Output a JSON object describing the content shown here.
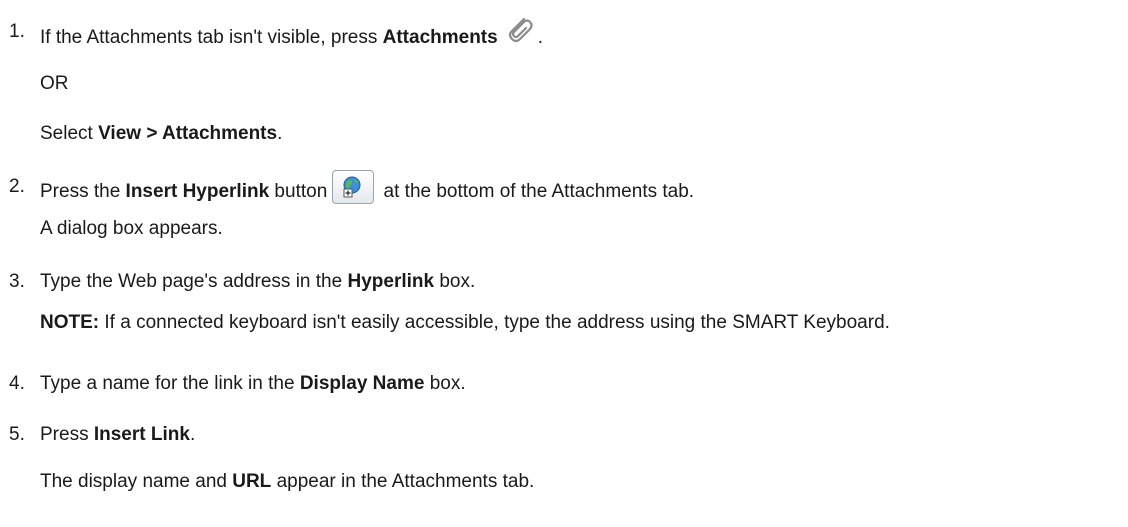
{
  "steps": [
    {
      "number": "1.",
      "lines": [
        {
          "t1": "If the Attachments tab isn't visible, press ",
          "b1": "Attachments",
          "t2": "."
        },
        {
          "text": "OR"
        },
        {
          "t1": "Select ",
          "b1": "View > Attachments",
          "t2": "."
        }
      ]
    },
    {
      "number": "2.",
      "lines": [
        {
          "t1": "Press the ",
          "b1": "Insert Hyperlink",
          "t2": " button",
          "t3": " at the bottom of the Attachments tab."
        },
        {
          "text": "A dialog box appears."
        }
      ]
    },
    {
      "number": "3.",
      "lines": [
        {
          "t1": "Type the Web page's address in the ",
          "b1": "Hyperlink",
          "t2": " box."
        },
        {
          "b1": "NOTE:",
          "t1": " If a connected keyboard isn't easily accessible, type the address using the SMART Keyboard."
        }
      ]
    },
    {
      "number": "4.",
      "lines": [
        {
          "t1": "Type a name for the link in the ",
          "b1": "Display Name",
          "t2": " box."
        }
      ]
    },
    {
      "number": "5.",
      "lines": [
        {
          "t1": "Press ",
          "b1": "Insert Link",
          "t2": "."
        },
        {
          "t1": "The display name and ",
          "b1": "URL",
          "t2": " appear in the Attachments tab."
        }
      ]
    }
  ],
  "icons": {
    "attachments": "paperclip-icon",
    "insert_hyperlink": "globe-plus-icon"
  }
}
